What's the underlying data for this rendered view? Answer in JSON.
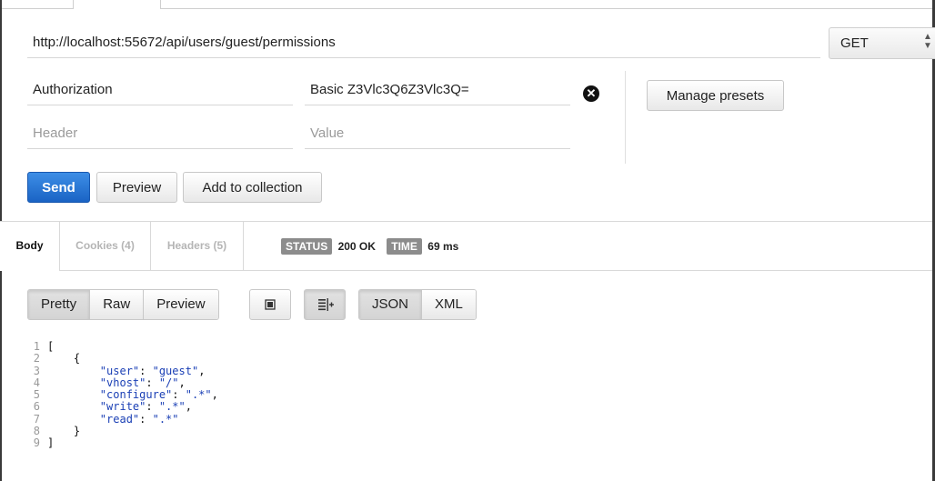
{
  "request": {
    "url": "http://localhost:55672/api/users/guest/permissions",
    "method": "GET",
    "headers": [
      {
        "key": "Authorization",
        "value": "Basic Z3Vlc3Q6Z3Vlc3Q="
      }
    ],
    "new_header": {
      "key_placeholder": "Header",
      "value_placeholder": "Value"
    },
    "manage_presets_label": "Manage presets",
    "send_label": "Send",
    "preview_label": "Preview",
    "add_to_collection_label": "Add to collection"
  },
  "response": {
    "tabs": [
      {
        "label": "Body"
      },
      {
        "label": "Cookies (4)"
      },
      {
        "label": "Headers (5)"
      }
    ],
    "status_badge": "STATUS",
    "status_value": "200 OK",
    "time_badge": "TIME",
    "time_value": "69 ms",
    "view_modes": [
      "Pretty",
      "Raw",
      "Preview"
    ],
    "formats": [
      "JSON",
      "XML"
    ],
    "icons": {
      "wrap": "fullscreen-icon",
      "indent": "indent-icon"
    },
    "body_lines": [
      "[",
      "    {",
      "        \"user\": \"guest\",",
      "        \"vhost\": \"/\",",
      "        \"configure\": \".*\",",
      "        \"write\": \".*\",",
      "        \"read\": \".*\"",
      "    }",
      "]"
    ],
    "line_numbers": [
      "1",
      "2",
      "3",
      "4",
      "5",
      "6",
      "7",
      "8",
      "9"
    ]
  },
  "colors": {
    "accent": "#1a63c4",
    "badge": "#8c8c8c",
    "json_string": "#1a3fb5"
  }
}
